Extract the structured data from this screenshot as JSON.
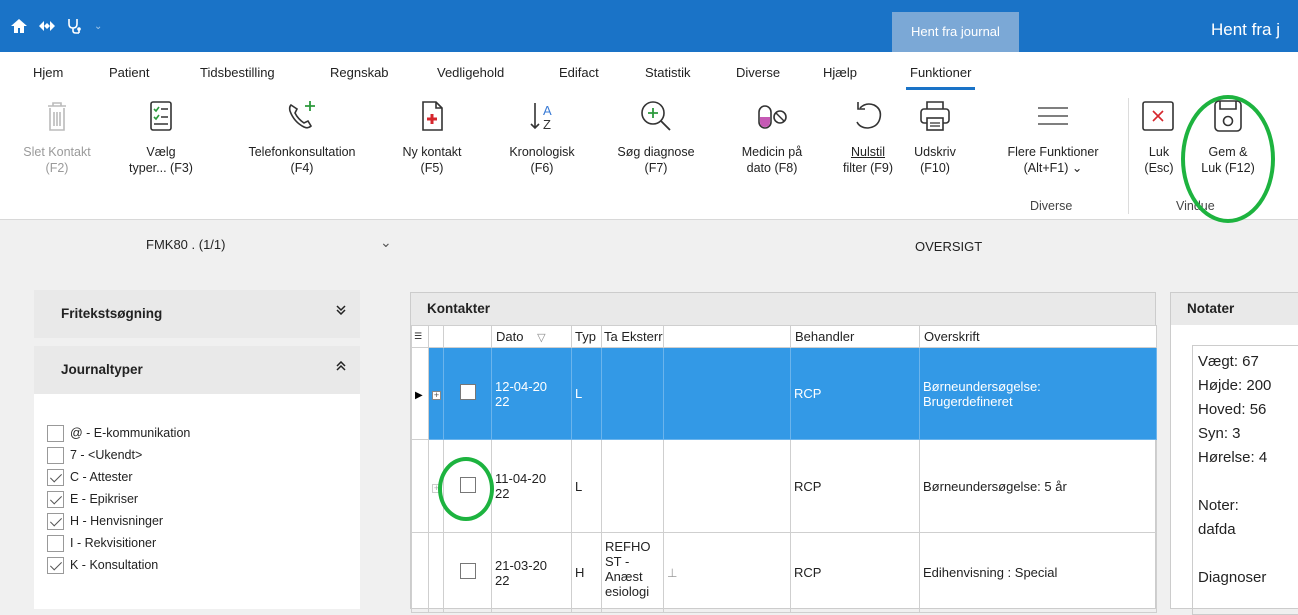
{
  "titlebar": {
    "icons": [
      "home-icon",
      "diamond-arrows-icon",
      "stethoscope-icon"
    ],
    "context_tab": "Hent fra journal",
    "title": "Hent fra j"
  },
  "menu": {
    "tabs": [
      "Hjem",
      "Patient",
      "Tidsbestilling",
      "Regnskab",
      "Vedligehold",
      "Edifact",
      "Statistik",
      "Diverse",
      "Hjælp",
      "Funktioner"
    ],
    "active": "Funktioner"
  },
  "ribbon": {
    "buttons": [
      {
        "line1": "Slet Kontakt",
        "line2": "(F2)",
        "icon": "trash-icon",
        "disabled": true
      },
      {
        "line1": "Vælg",
        "line2": "typer... (F3)",
        "icon": "checklist-icon"
      },
      {
        "line1": "Telefonkonsultation",
        "line2": "(F4)",
        "icon": "phone-plus-icon"
      },
      {
        "line1": "Ny kontakt",
        "line2": "(F5)",
        "icon": "new-document-icon"
      },
      {
        "line1": "Kronologisk",
        "line2": "(F6)",
        "icon": "sort-az-icon"
      },
      {
        "line1": "Søg diagnose",
        "line2": "(F7)",
        "icon": "zoom-plus-icon"
      },
      {
        "line1": "Medicin på",
        "line2": "dato (F8)",
        "icon": "pill-icon"
      },
      {
        "line1": "Nulstil",
        "line2": "filter (F9)",
        "icon": "undo-icon"
      },
      {
        "line1": "Udskriv",
        "line2": "(F10)",
        "icon": "printer-icon"
      },
      {
        "line1": "Flere Funktioner",
        "line2": "(Alt+F1) ⌄",
        "icon": "menu-lines-icon"
      },
      {
        "line1": "Luk",
        "line2": "(Esc)",
        "icon": "close-box-icon"
      },
      {
        "line1": "Gem &",
        "line2": "Luk (F12)",
        "icon": "save-icon"
      }
    ],
    "group_diverse": "Diverse",
    "group_vindue": "Vindue"
  },
  "subheader": {
    "fmk": "FMK80 . (1/1)",
    "oversigt": "OVERSIGT"
  },
  "left": {
    "fritekst": "Fritekstsøgning",
    "journaltyper": "Journaltyper",
    "types": [
      {
        "label": "@ - E-kommunikation",
        "checked": false
      },
      {
        "label": "7 - <Ukendt>",
        "checked": false
      },
      {
        "label": "C - Attester",
        "checked": true
      },
      {
        "label": "E - Epikriser",
        "checked": true
      },
      {
        "label": "H - Henvisninger",
        "checked": true
      },
      {
        "label": "I - Rekvisitioner",
        "checked": false
      },
      {
        "label": "K - Konsultation",
        "checked": true
      }
    ]
  },
  "kontakter": {
    "title": "Kontakter",
    "columns": [
      "Dato",
      "Typ",
      "Ta",
      "Eksterr",
      "",
      "Behandler",
      "Overskrift"
    ],
    "rows": [
      {
        "dato": "12-04-20\n22",
        "typ": "L",
        "ta": "",
        "ekstern": "",
        "behandler": "RCP",
        "overskrift": "Børneundersøgelse:\nBrugerdefineret",
        "selected": true
      },
      {
        "dato": "11-04-20\n22",
        "typ": "L",
        "ta": "",
        "ekstern": "",
        "behandler": "RCP",
        "overskrift": "Børneundersøgelse: 5 år",
        "selected": false
      },
      {
        "dato": "21-03-20\n22",
        "typ": "H",
        "ta": "",
        "ekstern": "REFHO\nST -\nAnæst\nesiologi",
        "behandler": "RCP",
        "overskrift": "Edihenvisning : Special",
        "selected": false
      }
    ]
  },
  "notater": {
    "title": "Notater",
    "text": "Vægt: 67\nHøjde: 200\nHoved: 56\nSyn: 3\nHørelse: 4\n\nNoter:\ndafda\n\nDiagnoser"
  }
}
